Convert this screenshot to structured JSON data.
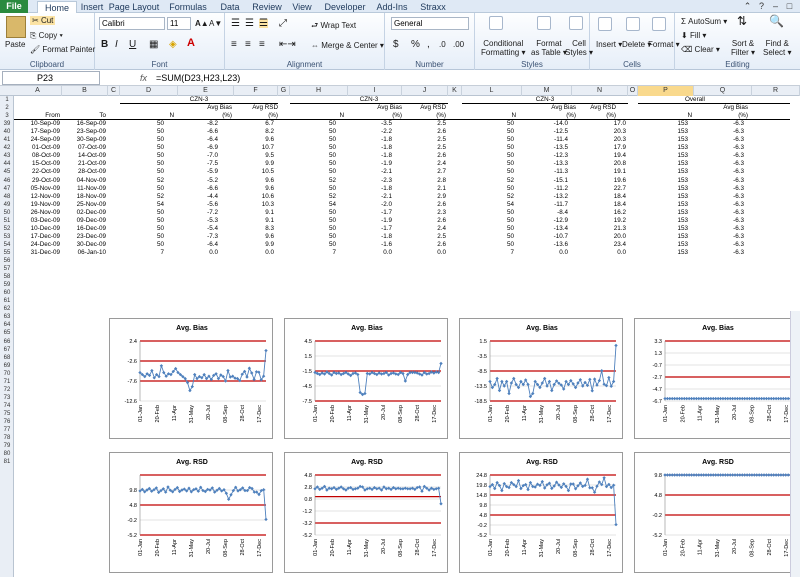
{
  "tabs": [
    "File",
    "Home",
    "Insert",
    "Page Layout",
    "Formulas",
    "Data",
    "Review",
    "View",
    "Developer",
    "Add-Ins",
    "Straxx"
  ],
  "ribbon": {
    "paste": "Paste",
    "cut": "Cut",
    "copy": "Copy",
    "format_painter": "Format Painter",
    "clipboard": "Clipboard",
    "font_name": "Calibri",
    "font_size": "11",
    "font_group": "Font",
    "bold": "B",
    "italic": "I",
    "underline": "U",
    "wrap_text": "Wrap Text",
    "merge_center": "Merge & Center",
    "alignment": "Alignment",
    "number_format": "General",
    "number_group": "Number",
    "currency": "$",
    "percent": "%",
    "cond_fmt_1": "Conditional",
    "cond_fmt_2": "Formatting",
    "fmt_table_1": "Format",
    "fmt_table_2": "as Table",
    "cell_styles_1": "Cell",
    "cell_styles_2": "Styles",
    "styles": "Styles",
    "insert": "Insert",
    "delete": "Delete",
    "format": "Format",
    "cells": "Cells",
    "autosum": "AutoSum",
    "fill": "Fill",
    "clear": "Clear",
    "sort_1": "Sort &",
    "sort_2": "Filter",
    "find_1": "Find &",
    "find_2": "Select",
    "editing": "Editing"
  },
  "formula_bar": {
    "cell": "P23",
    "fx": "fx",
    "formula": "=SUM(D23,H23,L23)"
  },
  "columns": [
    "A",
    "B",
    "C",
    "D",
    "E",
    "F",
    "G",
    "H",
    "I",
    "J",
    "K",
    "L",
    "M",
    "N",
    "O",
    "P",
    "Q",
    "R"
  ],
  "selected_column": "P",
  "header": {
    "group1": "CZN-3",
    "group2": "CZN-3",
    "group3": "CZN-3",
    "group4": "Overall",
    "avg_bias": "Avg Bias",
    "avg_rsd": "Avg RSD",
    "pct": "(%)",
    "from": "From",
    "to": "To",
    "n": "N"
  },
  "rows": [
    {
      "r": "39",
      "from": "10-Sep-09",
      "to": "16-Sep-09",
      "d1": "50",
      "b1": "-8.2",
      "s1": "6.7",
      "d2": "50",
      "b2": "-3.5",
      "s2": "2.5",
      "d3": "50",
      "b3": "-14.0",
      "s3": "17.0",
      "d4": "153",
      "b4": "-6.3"
    },
    {
      "r": "40",
      "from": "17-Sep-09",
      "to": "23-Sep-09",
      "d1": "50",
      "b1": "-6.6",
      "s1": "8.2",
      "d2": "50",
      "b2": "-2.2",
      "s2": "2.6",
      "d3": "50",
      "b3": "-12.5",
      "s3": "20.3",
      "d4": "153",
      "b4": "-6.3"
    },
    {
      "r": "41",
      "from": "24-Sep-09",
      "to": "30-Sep-09",
      "d1": "50",
      "b1": "-6.4",
      "s1": "9.6",
      "d2": "50",
      "b2": "-1.8",
      "s2": "2.5",
      "d3": "50",
      "b3": "-11.4",
      "s3": "20.3",
      "d4": "153",
      "b4": "-6.3"
    },
    {
      "r": "42",
      "from": "01-Oct-09",
      "to": "07-Oct-09",
      "d1": "50",
      "b1": "-6.9",
      "s1": "10.7",
      "d2": "50",
      "b2": "-1.8",
      "s2": "2.5",
      "d3": "50",
      "b3": "-13.5",
      "s3": "17.9",
      "d4": "153",
      "b4": "-6.3"
    },
    {
      "r": "43",
      "from": "08-Oct-09",
      "to": "14-Oct-09",
      "d1": "50",
      "b1": "-7.0",
      "s1": "9.5",
      "d2": "50",
      "b2": "-1.8",
      "s2": "2.6",
      "d3": "50",
      "b3": "-12.3",
      "s3": "19.4",
      "d4": "153",
      "b4": "-6.3"
    },
    {
      "r": "44",
      "from": "15-Oct-09",
      "to": "21-Oct-09",
      "d1": "50",
      "b1": "-7.5",
      "s1": "9.9",
      "d2": "50",
      "b2": "-1.9",
      "s2": "2.4",
      "d3": "50",
      "b3": "-13.3",
      "s3": "20.8",
      "d4": "153",
      "b4": "-6.3"
    },
    {
      "r": "45",
      "from": "22-Oct-09",
      "to": "28-Oct-09",
      "d1": "50",
      "b1": "-5.9",
      "s1": "10.5",
      "d2": "50",
      "b2": "-2.1",
      "s2": "2.7",
      "d3": "50",
      "b3": "-11.3",
      "s3": "19.1",
      "d4": "153",
      "b4": "-6.3"
    },
    {
      "r": "46",
      "from": "29-Oct-09",
      "to": "04-Nov-09",
      "d1": "52",
      "b1": "-5.2",
      "s1": "9.6",
      "d2": "52",
      "b2": "-2.3",
      "s2": "2.8",
      "d3": "52",
      "b3": "-15.1",
      "s3": "19.6",
      "d4": "153",
      "b4": "-6.3"
    },
    {
      "r": "47",
      "from": "05-Nov-09",
      "to": "11-Nov-09",
      "d1": "50",
      "b1": "-6.6",
      "s1": "9.6",
      "d2": "50",
      "b2": "-1.8",
      "s2": "2.1",
      "d3": "50",
      "b3": "-11.2",
      "s3": "22.7",
      "d4": "153",
      "b4": "-6.3"
    },
    {
      "r": "48",
      "from": "12-Nov-09",
      "to": "18-Nov-09",
      "d1": "52",
      "b1": "-4.4",
      "s1": "10.6",
      "d2": "52",
      "b2": "-2.1",
      "s2": "2.9",
      "d3": "52",
      "b3": "-13.2",
      "s3": "18.4",
      "d4": "153",
      "b4": "-6.3"
    },
    {
      "r": "49",
      "from": "19-Nov-09",
      "to": "25-Nov-09",
      "d1": "54",
      "b1": "-5.6",
      "s1": "10.3",
      "d2": "54",
      "b2": "-2.0",
      "s2": "2.6",
      "d3": "54",
      "b3": "-11.7",
      "s3": "18.4",
      "d4": "153",
      "b4": "-6.3"
    },
    {
      "r": "50",
      "from": "26-Nov-09",
      "to": "02-Dec-09",
      "d1": "50",
      "b1": "-7.2",
      "s1": "9.1",
      "d2": "50",
      "b2": "-1.7",
      "s2": "2.3",
      "d3": "50",
      "b3": "-8.4",
      "s3": "16.2",
      "d4": "153",
      "b4": "-6.3"
    },
    {
      "r": "51",
      "from": "03-Dec-09",
      "to": "09-Dec-09",
      "d1": "50",
      "b1": "-5.3",
      "s1": "9.1",
      "d2": "50",
      "b2": "-1.9",
      "s2": "2.6",
      "d3": "50",
      "b3": "-12.9",
      "s3": "19.2",
      "d4": "153",
      "b4": "-6.3"
    },
    {
      "r": "52",
      "from": "10-Dec-09",
      "to": "16-Dec-09",
      "d1": "50",
      "b1": "-5.4",
      "s1": "8.3",
      "d2": "50",
      "b2": "-1.7",
      "s2": "2.4",
      "d3": "50",
      "b3": "-13.4",
      "s3": "21.3",
      "d4": "153",
      "b4": "-6.3"
    },
    {
      "r": "53",
      "from": "17-Dec-09",
      "to": "23-Dec-09",
      "d1": "50",
      "b1": "-7.3",
      "s1": "9.6",
      "d2": "50",
      "b2": "-1.8",
      "s2": "2.5",
      "d3": "50",
      "b3": "-10.7",
      "s3": "20.0",
      "d4": "153",
      "b4": "-6.3"
    },
    {
      "r": "54",
      "from": "24-Dec-09",
      "to": "30-Dec-09",
      "d1": "50",
      "b1": "-6.4",
      "s1": "9.9",
      "d2": "50",
      "b2": "-1.6",
      "s2": "2.6",
      "d3": "50",
      "b3": "-13.6",
      "s3": "23.4",
      "d4": "153",
      "b4": "-6.3"
    },
    {
      "r": "55",
      "from": "31-Dec-09",
      "to": "06-Jan-10",
      "d1": "7",
      "b1": "0.0",
      "s1": "0.0",
      "d2": "7",
      "b2": "0.0",
      "s2": "0.0",
      "d3": "7",
      "b3": "0.0",
      "s3": "0.0",
      "d4": "153",
      "b4": "-6.3"
    }
  ],
  "row_numbers_top": [
    "1",
    "2",
    "3"
  ],
  "row_numbers_bottom": [
    "56",
    "57",
    "58",
    "59",
    "60",
    "61",
    "62",
    "63",
    "64",
    "65",
    "66",
    "67",
    "68",
    "69",
    "70",
    "71",
    "72",
    "73",
    "74",
    "75",
    "76",
    "77",
    "78",
    "79",
    "80",
    "81"
  ],
  "chart_data": [
    {
      "type": "line",
      "title": "Avg. Bias",
      "yticks": [
        "2.4",
        "-2.6",
        "-7.6",
        "-12.6"
      ],
      "ylim": [
        -12.6,
        2.4
      ],
      "limits": [
        2.4,
        -2.6,
        -7.6
      ],
      "xticks": [
        "01-Jan",
        "20-Feb",
        "11-Apr",
        "31-May",
        "20-Jul",
        "08-Sep",
        "28-Oct",
        "17-Dec"
      ],
      "y": [
        -5.5,
        -6,
        -6.5,
        -5.8,
        -6.2,
        -5,
        -6.8,
        -6,
        -6.5,
        -3.8,
        -5.5,
        -6.4,
        -5.8,
        -6,
        -5.2,
        -4.5,
        -5.5,
        -6,
        -6.5,
        -7,
        -8,
        -10,
        -9,
        -6,
        -7,
        -6.5,
        -6.8,
        -6,
        -7,
        -6.4,
        -7.2,
        -6.2,
        -5.8,
        -7,
        -6.1,
        -6.5,
        -7.6,
        -5,
        -6.6,
        -6.4,
        -6.9,
        -7,
        -7.5,
        -5.9,
        -5.2,
        -6.6,
        -4.4,
        -5.6,
        -7.2,
        -5.3,
        -5.4,
        -7.3,
        -6.4,
        0
      ]
    },
    {
      "type": "line",
      "title": "Avg. RSD",
      "yticks": [
        "9.8",
        "4.8",
        "-0.2",
        "-5.2"
      ],
      "ylim": [
        -5.2,
        14.8
      ],
      "limits": [
        14.8,
        4.8,
        -5.2
      ],
      "xticks": [
        "01-Jan",
        "20-Feb",
        "11-Apr",
        "31-May",
        "20-Jul",
        "08-Sep",
        "28-Oct",
        "17-Dec"
      ],
      "y": [
        9.5,
        10,
        9.2,
        9.8,
        10.3,
        9.4,
        9.9,
        10.5,
        9,
        9.6,
        10.2,
        9.1,
        10.8,
        9.7,
        9.2,
        10,
        10.6,
        9.3,
        9.8,
        10.1,
        9.5,
        10.4,
        9.2,
        9.9,
        10.2,
        9.4,
        10.7,
        9.6,
        9.3,
        10,
        9.8,
        10.5,
        9.1,
        9.7,
        10.3,
        9.5,
        9.9,
        8.7,
        6.7,
        8.2,
        9.6,
        10.7,
        9.5,
        9.9,
        10.5,
        9.6,
        9.6,
        10.6,
        10.3,
        9.1,
        9.1,
        8.3,
        9.6,
        9.9,
        0
      ]
    },
    {
      "type": "line",
      "title": "Avg. Bias",
      "yticks": [
        "4.5",
        "1.5",
        "-1.5",
        "-4.5",
        "-7.5"
      ],
      "ylim": [
        -7.5,
        4.5
      ],
      "limits": [
        4.5,
        -1.5,
        -7.5
      ],
      "xticks": [
        "01-Jan",
        "20-Feb",
        "11-Apr",
        "31-May",
        "20-Jul",
        "08-Sep",
        "28-Oct",
        "17-Dec"
      ],
      "y": [
        -1.8,
        -2,
        -2.2,
        -1.9,
        -2.1,
        -1.7,
        -2,
        -2.3,
        -1.8,
        -2,
        -1.9,
        -2.2,
        -2,
        -1.8,
        -2.1,
        -2.4,
        -2,
        -1.9,
        -2.2,
        -5.8,
        -6.2,
        -6,
        -2,
        -2.1,
        -1.8,
        -2,
        -2.2,
        -1.9,
        -2.1,
        -2,
        -1.8,
        -2.3,
        -2,
        -1.9,
        -2.1,
        -2.2,
        -1.8,
        -2,
        -3.5,
        -2.2,
        -1.8,
        -1.8,
        -1.8,
        -1.9,
        -2.1,
        -2.3,
        -1.8,
        -2.1,
        -2,
        -1.7,
        -1.9,
        -1.7,
        -1.8,
        0
      ]
    },
    {
      "type": "line",
      "title": "Avg. RSD",
      "yticks": [
        "4.8",
        "2.8",
        "0.8",
        "-1.2",
        "-3.2",
        "-5.2"
      ],
      "ylim": [
        -5.2,
        4.8
      ],
      "limits": [
        4.8,
        1.2,
        -3.2
      ],
      "xticks": [
        "01-Jan",
        "20-Feb",
        "11-Apr",
        "31-May",
        "20-Jul",
        "08-Sep",
        "28-Oct",
        "17-Dec"
      ],
      "y": [
        2.5,
        2.8,
        2.4,
        2.6,
        2.9,
        2.3,
        2.6,
        2.5,
        2.7,
        2.4,
        2.6,
        2.8,
        2.5,
        2.3,
        2.6,
        2.7,
        2.4,
        2.5,
        2.6,
        2.9,
        2.8,
        2.3,
        2.5,
        2.6,
        2.4,
        2.7,
        2.5,
        2.6,
        2.3,
        2.8,
        2.5,
        2.6,
        2.4,
        2.7,
        2.5,
        2.6,
        2.5,
        2.5,
        2.6,
        2.5,
        2.5,
        2.6,
        2.4,
        2.7,
        2.8,
        2.1,
        2.9,
        2.6,
        2.3,
        2.6,
        2.4,
        2.5,
        2.6,
        0
      ]
    },
    {
      "type": "line",
      "title": "Avg. Bias",
      "yticks": [
        "1.5",
        "-3.5",
        "-8.5",
        "-13.5",
        "-18.5"
      ],
      "ylim": [
        -18.5,
        1.5
      ],
      "limits": [
        1.5,
        -8.5,
        -18.5
      ],
      "xticks": [
        "01-Jan",
        "20-Feb",
        "11-Apr",
        "31-May",
        "20-Jul",
        "08-Sep",
        "28-Oct",
        "17-Dec"
      ],
      "y": [
        -12,
        -14,
        -13,
        -11,
        -15,
        -12,
        -13.5,
        -12,
        -16,
        -12.5,
        -11,
        -13,
        -14,
        -12,
        -13,
        -11.5,
        -13,
        -17,
        -16,
        -12,
        -13,
        -14,
        -12.5,
        -11,
        -13.5,
        -12,
        -15,
        -13,
        -11.8,
        -12.6,
        -13.2,
        -14.5,
        -12,
        -13,
        -11.7,
        -12.8,
        -14,
        -12.5,
        -11.4,
        -13.5,
        -12.3,
        -13.3,
        -11.3,
        -15.1,
        -11.2,
        -13.2,
        -11.7,
        -8.4,
        -12.9,
        -13.4,
        -10.7,
        -13.6,
        -12,
        0
      ]
    },
    {
      "type": "line",
      "title": "Avg. RSD",
      "yticks": [
        "24.8",
        "19.8",
        "14.8",
        "9.8",
        "4.8",
        "-0.2",
        "-5.2"
      ],
      "ylim": [
        -5.2,
        24.8
      ],
      "limits": [
        24.8,
        14.8,
        4.8
      ],
      "xticks": [
        "01-Jan",
        "20-Feb",
        "11-Apr",
        "31-May",
        "20-Jul",
        "08-Sep",
        "28-Oct",
        "17-Dec"
      ],
      "y": [
        19,
        20,
        18,
        21,
        19.5,
        17,
        20.5,
        19,
        18.5,
        21,
        20,
        19,
        22,
        18,
        19.5,
        20,
        17.5,
        21,
        19,
        18.8,
        20.2,
        19.6,
        21.5,
        18.3,
        19.9,
        20.7,
        18.1,
        19.3,
        21.2,
        19.8,
        18.6,
        20.4,
        19.1,
        17,
        20.3,
        20.3,
        17.9,
        19.4,
        20.8,
        19.1,
        19.6,
        22.7,
        18.4,
        18.4,
        16.2,
        19.2,
        21.3,
        20,
        23.4,
        19,
        20.1,
        18.5,
        19.7,
        0
      ]
    },
    {
      "type": "line",
      "title": "Avg. Bias",
      "yticks": [
        "3.3",
        "1.3",
        "-0.7",
        "-2.7",
        "-4.7",
        "-6.7"
      ],
      "ylim": [
        -6.7,
        3.3
      ],
      "limits": [
        3.3,
        -2.7
      ],
      "xticks": [
        "01-Jan",
        "20-Feb",
        "11-Apr",
        "31-May",
        "20-Jul",
        "08-Sep",
        "28-Oct",
        "17-Dec"
      ],
      "y": [
        -6.3,
        -6.3,
        -6.3,
        -6.3,
        -6.3,
        -6.3,
        -6.3,
        -6.3,
        -6.3,
        -6.3,
        -6.3,
        -6.3,
        -6.3,
        -6.3,
        -6.3,
        -6.3,
        -6.3,
        -6.3,
        -6.3,
        -6.3,
        -6.3,
        -6.3,
        -6.3,
        -6.3,
        -6.3,
        -6.3,
        -6.3,
        -6.3,
        -6.3,
        -6.3,
        -6.3,
        -6.3,
        -6.3,
        -6.3,
        -6.3,
        -6.3,
        -6.3,
        -6.3,
        -6.3,
        -6.3,
        -6.3,
        -6.3,
        -6.3,
        -6.3,
        -6.3,
        -6.3,
        -6.3,
        -6.3,
        -6.3,
        -6.3,
        -6.3,
        -6.3,
        -6.3,
        -6.3
      ]
    },
    {
      "type": "line",
      "title": "Avg. RSD",
      "yticks": [
        "9.8",
        "4.8",
        "-0.2",
        "-5.2"
      ],
      "ylim": [
        -5.2,
        9.8
      ],
      "limits": [
        9.8,
        4.8,
        -0.2
      ],
      "xticks": [
        "01-Jan",
        "20-Feb",
        "11-Apr",
        "31-May",
        "20-Jul",
        "08-Sep",
        "28-Oct",
        "17-Dec"
      ],
      "y": [
        9.8,
        9.8,
        9.8,
        9.8,
        9.8,
        9.8,
        9.8,
        9.8,
        9.8,
        9.8,
        9.8,
        9.8,
        9.8,
        9.8,
        9.8,
        9.8,
        9.8,
        9.8,
        9.8,
        9.8,
        9.8,
        9.8,
        9.8,
        9.8,
        9.8,
        9.8,
        9.8,
        9.8,
        9.8,
        9.8,
        9.8,
        9.8,
        9.8,
        9.8,
        9.8,
        9.8,
        9.8,
        9.8,
        9.8,
        9.8,
        9.8,
        9.8,
        9.8,
        9.8,
        9.8,
        9.8,
        9.8,
        9.8,
        9.8,
        9.8,
        9.8,
        9.8,
        9.8,
        9.8
      ]
    }
  ],
  "colors": {
    "file_tab": "#2a8a3e",
    "series": "#4f81bd",
    "limit_line": "#c00000",
    "selected_col": "#f9d98d"
  }
}
